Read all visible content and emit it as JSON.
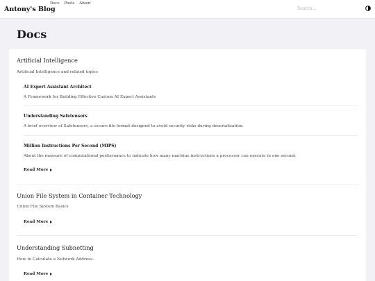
{
  "header": {
    "brand": "Antony's Blog",
    "nav": [
      {
        "label": "Docs"
      },
      {
        "label": "Posts"
      },
      {
        "label": "About"
      }
    ],
    "search_placeholder": "Search...",
    "theme_icon": "contrast-icon"
  },
  "page": {
    "title": "Docs"
  },
  "sections": [
    {
      "title": "Artificial Intelligence",
      "description": "Artificial Intelligence and related topics",
      "items": [
        {
          "title": "AI Expert Assistant Architect",
          "description": "A Framework for Building Effective Custom AI Expert Assistants"
        },
        {
          "title": "Understanding Safetensors",
          "description": "A brief overview of Safetensors, a secure file format designed to avoid security risks during deserialisation."
        },
        {
          "title": "Million Instructions Per Second (MIPS)",
          "description": "About the measure of computational performance to indicate how many machine instructions a processor can execute in one second."
        }
      ],
      "read_more": "Read More"
    },
    {
      "title": "Union File System in Container Technology",
      "description": "Union File System Basics",
      "read_more": "Read More"
    },
    {
      "title": "Understanding Subnetting",
      "description": "How to Calculate a Network Address.",
      "read_more": "Read More"
    }
  ]
}
